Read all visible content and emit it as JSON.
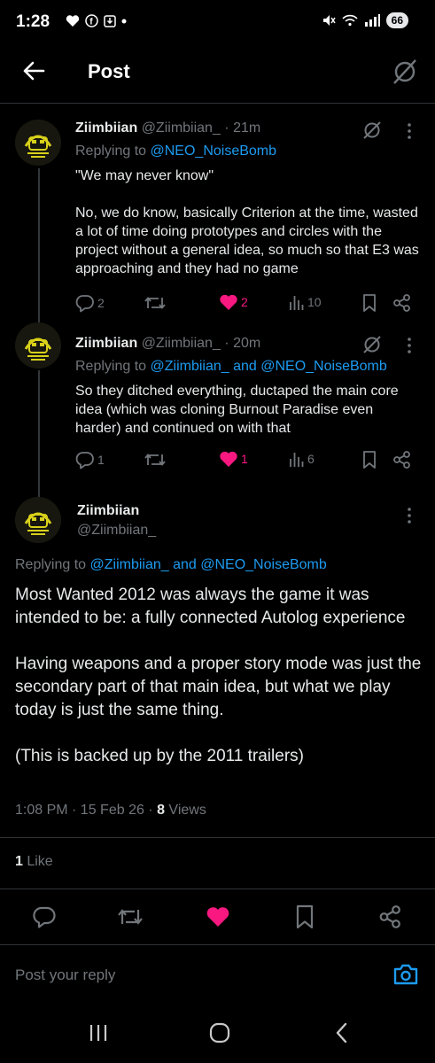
{
  "status_bar": {
    "time": "1:28",
    "battery": "66"
  },
  "header": {
    "title": "Post"
  },
  "replies": [
    {
      "name": "Ziimbiian",
      "handle": "@Ziimbiian_",
      "time": "· 21m",
      "replying_prefix": "Replying to ",
      "replying_to": "@NEO_NoiseBomb",
      "text": "\"We may never know\"\n\nNo, we do know, basically Criterion at the time, wasted a lot of time doing prototypes and circles with the project without a general idea, so much so that E3 was approaching and they had no game",
      "stats": {
        "replies": "2",
        "likes": "2",
        "views": "10"
      }
    },
    {
      "name": "Ziimbiian",
      "handle": "@Ziimbiian_",
      "time": "· 20m",
      "replying_prefix": "Replying to ",
      "replying_to": "@Ziimbiian_ and @NEO_NoiseBomb",
      "text": "So they ditched everything, ductaped the main core idea (which was cloning Burnout Paradise even harder) and continued on with that",
      "stats": {
        "replies": "1",
        "likes": "1",
        "views": "6"
      }
    }
  ],
  "main_post": {
    "name": "Ziimbiian",
    "handle": "@Ziimbiian_",
    "replying_prefix": "Replying to ",
    "replying_to": "@Ziimbiian_ and @NEO_NoiseBomb",
    "text": "Most Wanted 2012 was always the game it was intended to be: a fully connected Autolog experience\n\nHaving weapons and a proper story mode was just the secondary part of that main idea, but what we play today is just the same thing.\n\n(This is backed up by the 2011 trailers)",
    "timestamp": "1:08 PM · 15 Feb 26 · ",
    "views_count": "8",
    "views_label": " Views",
    "likes_count": "1",
    "likes_label": " Like"
  },
  "reply_bar": {
    "placeholder": "Post your reply"
  },
  "colors": {
    "like": "#f91880",
    "link": "#1d9bf0",
    "muted": "#71767b"
  },
  "icons": [
    "back-arrow-icon",
    "grok-icon",
    "reply-icon",
    "repost-icon",
    "heart-icon",
    "views-icon",
    "bookmark-icon",
    "share-icon",
    "camera-icon"
  ]
}
